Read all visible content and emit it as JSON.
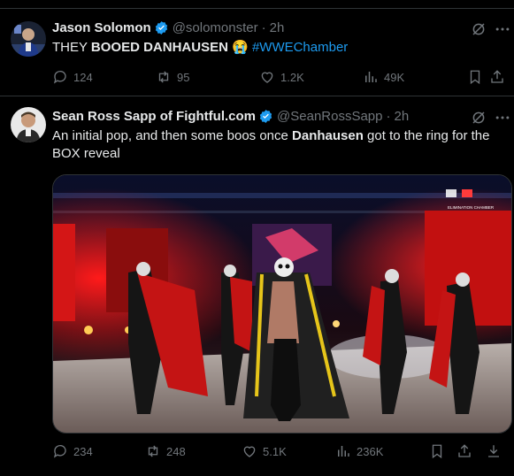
{
  "tweets": [
    {
      "author_name": "Jason Solomon",
      "handle": "@solomonster",
      "separator": "·",
      "time": "2h",
      "text_before": "THEY ",
      "text_bold": "BOOED DANHAUSEN",
      "text_emoji": " 😭 ",
      "hashtag": "#WWEChamber",
      "replies": "124",
      "reposts": "95",
      "likes": "1.2K",
      "views": "49K"
    },
    {
      "author_name": "Sean Ross Sapp of Fightful.com",
      "handle": "@SeanRossSapp",
      "separator": "·",
      "time": "2h",
      "text_part1": "An initial pop, and then some boos once ",
      "text_bold": "Danhausen",
      "text_part2": " got to the ring for the",
      "text_line2": "BOX reveal",
      "replies": "234",
      "reposts": "248",
      "likes": "5.1K",
      "views": "236K",
      "media_logo_text": "ELIMINATION CHAMBER"
    }
  ],
  "colors": {
    "background": "#000000",
    "text": "#e7e9ea",
    "muted": "#71767b",
    "link": "#1d9bf0",
    "verified": "#1d9bf0",
    "divider": "#2f3336"
  },
  "icons": [
    "verified-badge-icon",
    "grok-icon",
    "more-icon",
    "reply-icon",
    "repost-icon",
    "like-icon",
    "views-icon",
    "bookmark-icon",
    "share-icon"
  ]
}
